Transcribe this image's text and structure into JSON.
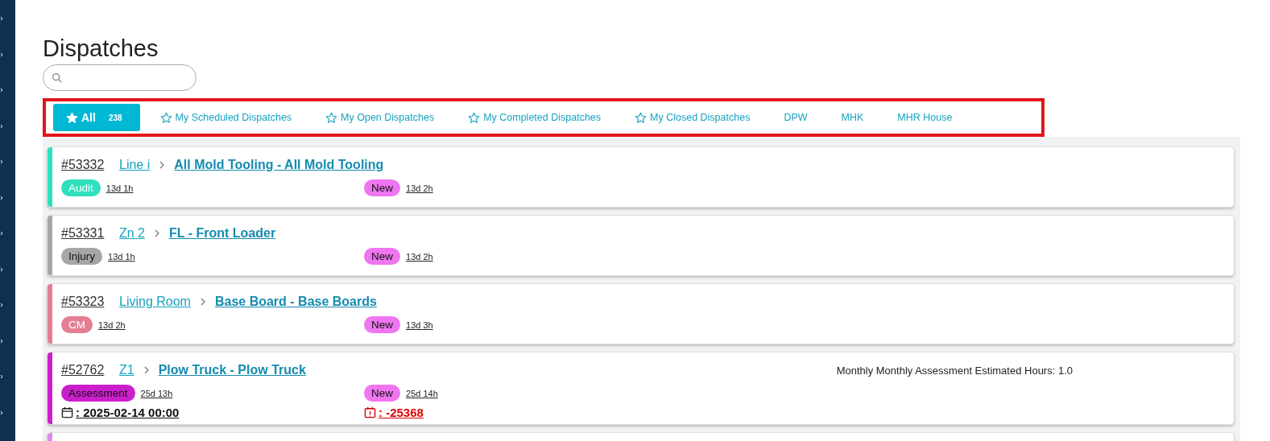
{
  "title": "Dispatches",
  "tabs": [
    {
      "label": "All",
      "count": "238",
      "starred": true,
      "selected": true
    },
    {
      "label": "My Scheduled Dispatches",
      "starred": true,
      "selected": false
    },
    {
      "label": "My Open Dispatches",
      "starred": true,
      "selected": false
    },
    {
      "label": "My Completed Dispatches",
      "starred": true,
      "selected": false
    },
    {
      "label": "My Closed Dispatches",
      "starred": true,
      "selected": false
    },
    {
      "label": "DPW",
      "starred": false,
      "selected": false
    },
    {
      "label": "MHK",
      "starred": false,
      "selected": false
    },
    {
      "label": "MHR House",
      "starred": false,
      "selected": false
    }
  ],
  "dispatches": [
    {
      "color": "#2ee0bd",
      "number": "#53332",
      "location": "Line i",
      "asset": "All Mold Tooling - All Mold Tooling",
      "type": {
        "label": "Audit",
        "color": "#2ee0bd"
      },
      "type_age": "13d 1h",
      "status": {
        "label": "New",
        "color": "#f075f0"
      },
      "status_age": "13d 2h"
    },
    {
      "color": "#a6a6a6",
      "number": "#53331",
      "location": "Zn 2",
      "asset": "FL - Front Loader",
      "type": {
        "label": "Injury",
        "color": "#a6a6a6"
      },
      "type_age": "13d 1h",
      "status": {
        "label": "New",
        "color": "#f075f0"
      },
      "status_age": "13d 2h"
    },
    {
      "color": "#e47f93",
      "number": "#53323",
      "location": "Living Room",
      "asset": "Base Board - Base Boards",
      "type": {
        "label": "CM",
        "color": "#e47f93"
      },
      "type_age": "13d 2h",
      "status": {
        "label": "New",
        "color": "#f075f0"
      },
      "status_age": "13d 3h"
    },
    {
      "color": "#cc1fcc",
      "number": "#52762",
      "location": "Z1",
      "asset": "Plow Truck - Plow Truck",
      "type": {
        "label": "Assessment",
        "color": "#cc1fcc"
      },
      "type_age": "25d 13h",
      "status": {
        "label": "New",
        "color": "#f075f0"
      },
      "status_age": "25d 14h",
      "note": "Monthly Monthly Assessment Estimated Hours: 1.0",
      "scheduled": ": 2025-02-14 00:00",
      "due": ": -25368"
    },
    {
      "color": "#d98be8"
    }
  ]
}
